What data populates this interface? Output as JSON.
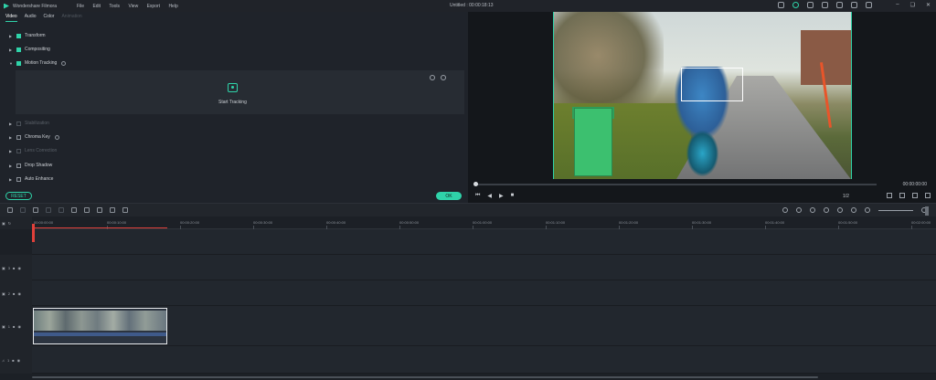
{
  "app": {
    "name": "Wondershare Filmora",
    "menu": [
      "File",
      "Edit",
      "Tools",
      "View",
      "Export",
      "Help"
    ],
    "document_title": "Untitled : 00:00:18:13"
  },
  "panel": {
    "tabs": [
      {
        "label": "Video",
        "state": "active"
      },
      {
        "label": "Audio",
        "state": "normal"
      },
      {
        "label": "Color",
        "state": "normal"
      },
      {
        "label": "Animation",
        "state": "disabled"
      }
    ],
    "properties": [
      {
        "label": "Transform",
        "checked": true,
        "enabled": true
      },
      {
        "label": "Compositing",
        "checked": true,
        "enabled": true
      },
      {
        "label": "Motion Tracking",
        "checked": true,
        "enabled": true,
        "expanded": true
      },
      {
        "label": "Stabilization",
        "checked": false,
        "enabled": false
      },
      {
        "label": "Chroma Key",
        "checked": false,
        "enabled": true
      },
      {
        "label": "Lens Correction",
        "checked": false,
        "enabled": false
      },
      {
        "label": "Drop Shadow",
        "checked": false,
        "enabled": true
      },
      {
        "label": "Auto Enhance",
        "checked": false,
        "enabled": true
      }
    ],
    "start_tracking_label": "Start Tracking",
    "reset_label": "RESET",
    "ok_label": "OK"
  },
  "preview": {
    "timecode": "00:00:00:00",
    "ratio": "1/2",
    "playhead_fraction": 0.0
  },
  "timeline": {
    "ruler_labels": [
      "00:00:00:00",
      "00:00:10:00",
      "00:00:20:00",
      "00:00:30:00",
      "00:00:40:00",
      "00:00:50:00",
      "00:01:00:00",
      "00:01:10:00",
      "00:01:20:00",
      "00:01:30:00",
      "00:01:40:00",
      "00:01:50:00",
      "00:02:00:00"
    ],
    "tracks": [
      {
        "label": "3",
        "type": "video"
      },
      {
        "label": "2",
        "type": "video"
      },
      {
        "label": "1",
        "type": "video"
      },
      {
        "label": "1",
        "type": "audio"
      }
    ]
  },
  "colors": {
    "accent": "#2fd3a9",
    "playhead": "#e0403a",
    "background": "#1b1f25"
  }
}
